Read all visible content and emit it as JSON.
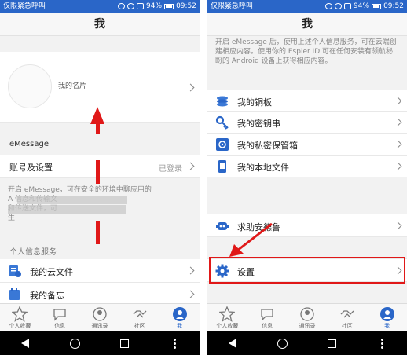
{
  "status_bar": {
    "carrier": "仅限紧急呼叫",
    "battery": "94%",
    "time": "09:52"
  },
  "left_screen": {
    "title": "我",
    "card_label": "我的名片",
    "emessage_label": "eMessage",
    "account_label": "账号及设置",
    "account_value": "已登录",
    "desc_line1": "开启 eMessage，可在安全的环境中聊应用的",
    "desc_line2": "A                                   信息和传输文",
    "desc_line3": "                                   和传送文件，可",
    "desc_line4": "生",
    "section_personal": "个人信息服务",
    "cloud_files": "我的云文件",
    "memo": "我的备忘"
  },
  "right_screen": {
    "title": "我",
    "desc": "开启 eMessage 后，使用上述个人信息服务，可在云端创建相应内容。使用你的 Espier ID 可在任何安装有领航秘盼的 Android 设备上获得相应内容。",
    "items": [
      {
        "label": "我的铜板"
      },
      {
        "label": "我的密钥串"
      },
      {
        "label": "我的私密保管箱"
      },
      {
        "label": "我的本地文件"
      }
    ],
    "help": "求助安德鲁",
    "settings": "设置"
  },
  "tabs": [
    {
      "label": "个人收藏",
      "icon": "star-icon"
    },
    {
      "label": "信息",
      "icon": "chat-icon"
    },
    {
      "label": "通讯录",
      "icon": "contacts-icon"
    },
    {
      "label": "社区",
      "icon": "handshake-icon"
    },
    {
      "label": "我",
      "icon": "person-icon"
    }
  ],
  "colors": {
    "accent": "#2a66c8",
    "annotation": "#e01818"
  }
}
